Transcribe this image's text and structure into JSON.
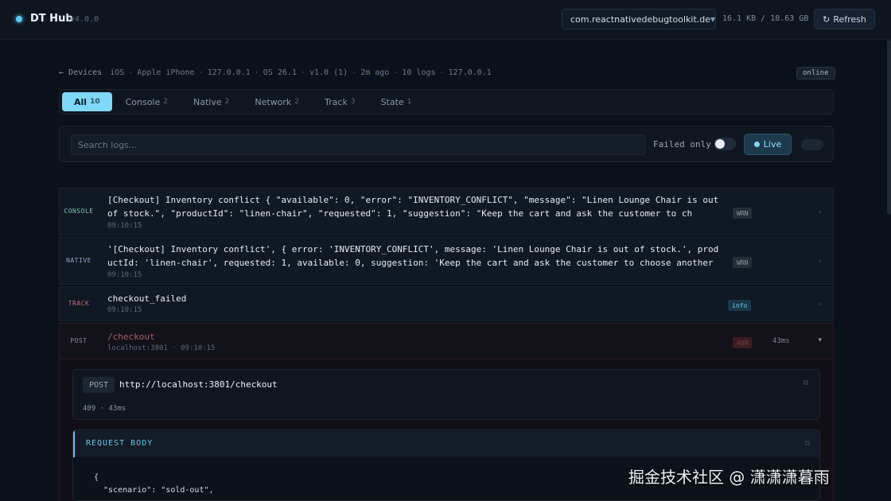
{
  "header": {
    "brand": "DT Hub",
    "version": "v4.0.0",
    "app_selector": "com.reactnativedebugtoolkit.de",
    "storage": "16.1 KB / 18.63 GB",
    "refresh_label": "Refresh"
  },
  "breadcrumb": {
    "back": "Devices",
    "parts": [
      "iOS",
      "Apple iPhone",
      "127.0.0.1",
      "OS 26.1",
      "v1.0 (1)",
      "2m ago",
      "10 logs",
      "127.0.0.1"
    ],
    "status": "online"
  },
  "tabs": [
    {
      "label": "All",
      "count": "10"
    },
    {
      "label": "Console",
      "count": "2"
    },
    {
      "label": "Native",
      "count": "2"
    },
    {
      "label": "Network",
      "count": "2"
    },
    {
      "label": "Track",
      "count": "3"
    },
    {
      "label": "State",
      "count": "1"
    }
  ],
  "filters": {
    "search_placeholder": "Search logs...",
    "failed_only_label": "Failed only",
    "live_label": "Live"
  },
  "logs": [
    {
      "type": "CONSOLE",
      "message": "[Checkout] Inventory conflict { \"available\": 0, \"error\": \"INVENTORY_CONFLICT\", \"message\": \"Linen Lounge Chair is out of stock.\", \"productId\": \"linen-chair\", \"requested\": 1, \"suggestion\": \"Keep the cart and ask the customer to ch",
      "time": "09:10:15",
      "level": "WRN"
    },
    {
      "type": "NATIVE",
      "message": "'[Checkout] Inventory conflict', { error: 'INVENTORY_CONFLICT', message: 'Linen Lounge Chair is out of stock.', productId: 'linen-chair', requested: 1, available: 0, suggestion: 'Keep the cart and ask the customer to choose another item.' }",
      "time": "09:10:15",
      "level": "WRN"
    },
    {
      "type": "TRACK",
      "message": "checkout_failed",
      "time": "09:10:15",
      "level": "info"
    }
  ],
  "network": {
    "method": "POST",
    "path": "/checkout",
    "host_time": "localhost:3801 · 09:10:15",
    "status": "409",
    "duration": "43ms",
    "url": "http://localhost:3801/checkout",
    "meta": "409 · 43ms",
    "body_title": "REQUEST BODY",
    "body_lines": [
      "{",
      "  \"scenario\": \"sold-out\","
    ]
  },
  "watermark": "掘金技术社区 @ 潇潇潇暮雨",
  "colors": {
    "accent": "#7fd8f7",
    "console": "#7fc0a8",
    "native": "#8fa3c4",
    "track": "#c46a78",
    "post": "#8794a3"
  }
}
